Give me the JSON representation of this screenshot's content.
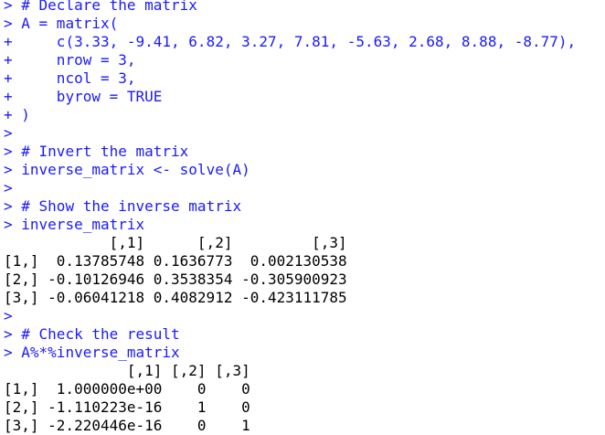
{
  "console": {
    "prompt_primary": ">",
    "prompt_continue": "+",
    "lines": [
      {
        "kind": "input",
        "prompt": ">",
        "text": " # Declare the matrix"
      },
      {
        "kind": "input",
        "prompt": ">",
        "text": " A = matrix("
      },
      {
        "kind": "input",
        "prompt": "+",
        "text": "     c(3.33, -9.41, 6.82, 3.27, 7.81, -5.63, 2.68, 8.88, -8.77),"
      },
      {
        "kind": "input",
        "prompt": "+",
        "text": "     nrow = 3,"
      },
      {
        "kind": "input",
        "prompt": "+",
        "text": "     ncol = 3,"
      },
      {
        "kind": "input",
        "prompt": "+",
        "text": "     byrow = TRUE"
      },
      {
        "kind": "input",
        "prompt": "+",
        "text": " )"
      },
      {
        "kind": "input",
        "prompt": ">",
        "text": ""
      },
      {
        "kind": "input",
        "prompt": ">",
        "text": " # Invert the matrix"
      },
      {
        "kind": "input",
        "prompt": ">",
        "text": " inverse_matrix <- solve(A)"
      },
      {
        "kind": "input",
        "prompt": ">",
        "text": ""
      },
      {
        "kind": "input",
        "prompt": ">",
        "text": " # Show the inverse matrix"
      },
      {
        "kind": "input",
        "prompt": ">",
        "text": " inverse_matrix"
      },
      {
        "kind": "output",
        "prompt": "",
        "text": "            [,1]      [,2]         [,3]"
      },
      {
        "kind": "output",
        "prompt": "",
        "text": "[1,]  0.13785748 0.1636773  0.002130538"
      },
      {
        "kind": "output",
        "prompt": "",
        "text": "[2,] -0.10126946 0.3538354 -0.305900923"
      },
      {
        "kind": "output",
        "prompt": "",
        "text": "[3,] -0.06041218 0.4082912 -0.423111785"
      },
      {
        "kind": "input",
        "prompt": ">",
        "text": ""
      },
      {
        "kind": "input",
        "prompt": ">",
        "text": " # Check the result"
      },
      {
        "kind": "input",
        "prompt": ">",
        "text": " A%*%inverse_matrix"
      },
      {
        "kind": "output",
        "prompt": "",
        "text": "              [,1] [,2] [,3]"
      },
      {
        "kind": "output",
        "prompt": "",
        "text": "[1,]  1.000000e+00    0    0"
      },
      {
        "kind": "output",
        "prompt": "",
        "text": "[2,] -1.110223e-16    1    0"
      },
      {
        "kind": "output",
        "prompt": "",
        "text": "[3,] -2.220446e-16    0    1"
      }
    ]
  },
  "colors": {
    "command": "#1a1aff",
    "output": "#000000",
    "background": "#ffffff"
  }
}
